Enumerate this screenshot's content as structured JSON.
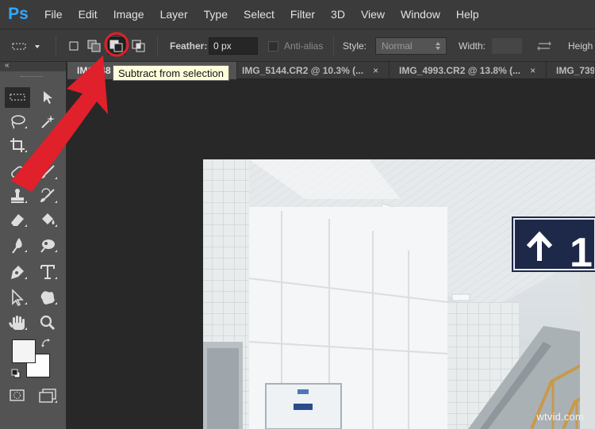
{
  "app": {
    "logo": "Ps"
  },
  "menu": [
    "File",
    "Edit",
    "Image",
    "Layer",
    "Type",
    "Select",
    "Filter",
    "3D",
    "View",
    "Window",
    "Help"
  ],
  "options": {
    "feather_label": "Feather:",
    "feather_value": "0 px",
    "antialias_label": "Anti-alias",
    "style_label": "Style:",
    "style_value": "Normal",
    "width_label": "Width:",
    "height_label": "Heigh"
  },
  "tooltip": "Subtract from selection",
  "tabs": [
    {
      "label": "IMG_48",
      "active": true
    },
    {
      "label": "IMG_5144.CR2 @ 10.3% (...",
      "active": false
    },
    {
      "label": "IMG_4993.CR2 @ 13.8% (...",
      "active": false
    },
    {
      "label": "IMG_739",
      "active": false
    }
  ],
  "tab_close_glyph": "×",
  "sign": {
    "text": "1"
  },
  "watermark": "wtvid.com",
  "colors": {
    "annotation_red": "#e0202a",
    "accent_blue": "#31a8ff"
  }
}
